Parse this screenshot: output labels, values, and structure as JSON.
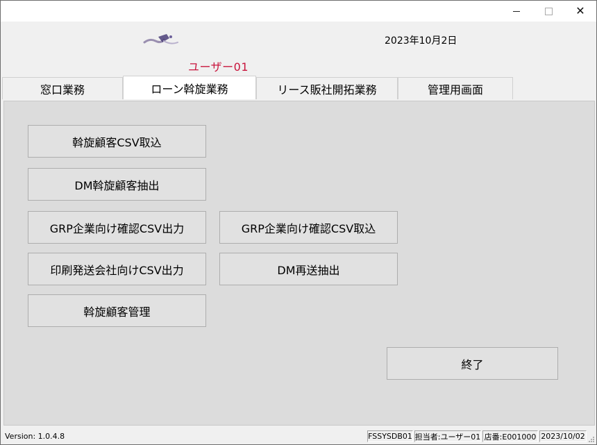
{
  "header": {
    "date": "2023年10月2日",
    "user": "ユーザー01"
  },
  "tabs": [
    {
      "label": "窓口業務",
      "active": false
    },
    {
      "label": "ローン斡旋業務",
      "active": true
    },
    {
      "label": "リース販社開拓業務",
      "active": false
    },
    {
      "label": "管理用画面",
      "active": false
    }
  ],
  "buttons": {
    "import_csv": "斡旋顧客CSV取込",
    "dm_extract": "DM斡旋顧客抽出",
    "grp_export": "GRP企業向け確認CSV出力",
    "grp_import": "GRP企業向け確認CSV取込",
    "print_export": "印刷発送会社向けCSV出力",
    "dm_resend": "DM再送抽出",
    "customer_manage": "斡旋顧客管理",
    "exit": "終了"
  },
  "status": {
    "version": "Version: 1.0.4.8",
    "db": "FSSYSDB01",
    "staff": "担当者:ユーザー01",
    "store": "店番:E001000",
    "date": "2023/10/02"
  },
  "colors": {
    "user_text": "#c8143c",
    "panel_bg": "#dcdcdc",
    "button_bg": "#e1e1e1"
  }
}
